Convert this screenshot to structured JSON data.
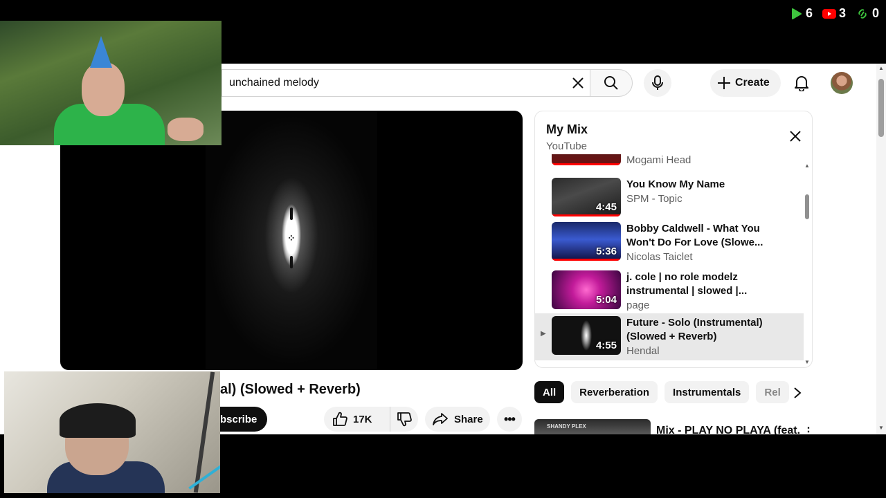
{
  "overlay": {
    "counters": [
      {
        "icon": "green-play-icon",
        "value": "6",
        "color": "#3ec43e"
      },
      {
        "icon": "youtube-icon",
        "value": "3",
        "color": "#ff0000"
      },
      {
        "icon": "link-icon",
        "value": "0",
        "color": "#3ec43e"
      }
    ]
  },
  "header": {
    "search_value": "unchained melody",
    "create_label": "Create"
  },
  "video": {
    "title_fragment": "al) (Slowed + Reverb)",
    "subscribe_label": "bscribe",
    "like_count": "17K",
    "share_label": "Share"
  },
  "mix": {
    "title": "My Mix",
    "subtitle": "YouTube",
    "items": [
      {
        "title": "",
        "channel": "Mogami Head",
        "duration": "",
        "active": false
      },
      {
        "title": "You Know My Name",
        "channel": "SPM - Topic",
        "duration": "4:45",
        "active": false
      },
      {
        "title": "Bobby Caldwell - What You Won't Do For Love (Slowe...",
        "channel": "Nicolas Taiclet",
        "duration": "5:36",
        "active": false
      },
      {
        "title": "j. cole | no role modelz instrumental | slowed |...",
        "channel": "page",
        "duration": "5:04",
        "active": false
      },
      {
        "title": "Future - Solo (Instrumental) (Slowed + Reverb)",
        "channel": "Hendal",
        "duration": "4:55",
        "active": true
      }
    ]
  },
  "chips": [
    "All",
    "Reverberation",
    "Instrumentals",
    "Rel"
  ],
  "recommendation": {
    "title": "Mix - PLAY NO PLAYA (feat.",
    "thumb_label": "SHANDY PLEX"
  }
}
